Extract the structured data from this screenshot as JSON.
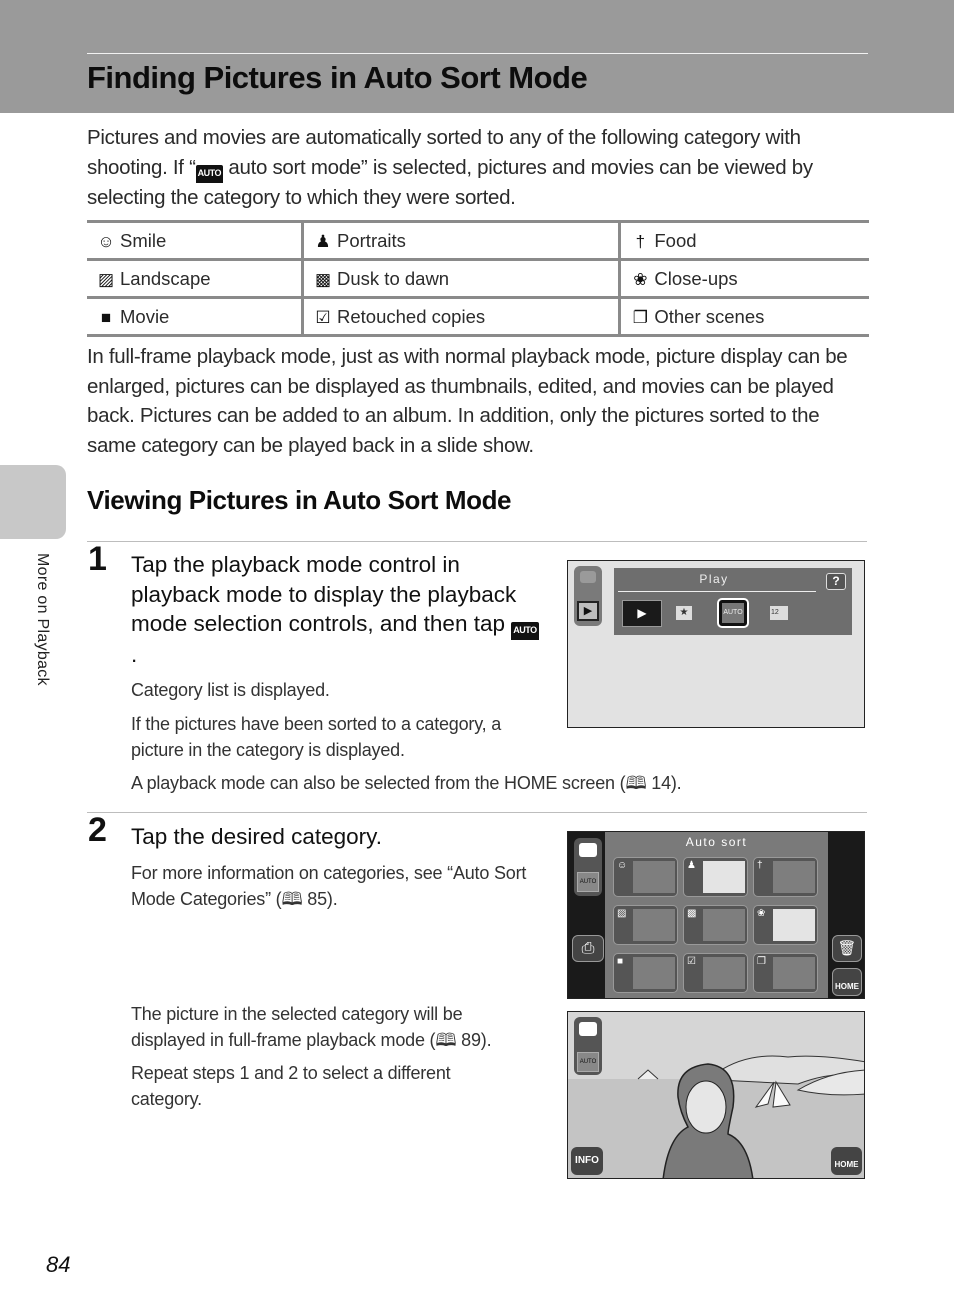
{
  "header": {
    "title": "Finding Pictures in Auto Sort Mode"
  },
  "intro": {
    "part1": "Pictures and movies are automatically sorted to any of the following category with shooting. If “",
    "icon": "AUTO",
    "part2": " auto sort mode” is selected, pictures and movies can be viewed by selecting the category to which they were sorted."
  },
  "categories": [
    [
      {
        "icon": "smile-icon",
        "glyph": "☺",
        "label": "Smile"
      },
      {
        "icon": "portrait-icon",
        "glyph": "♟",
        "label": "Portraits"
      },
      {
        "icon": "food-icon",
        "glyph": "†",
        "label": "Food"
      }
    ],
    [
      {
        "icon": "landscape-icon",
        "glyph": "▨",
        "label": "Landscape"
      },
      {
        "icon": "dusk-icon",
        "glyph": "▩",
        "label": "Dusk to dawn"
      },
      {
        "icon": "closeup-icon",
        "glyph": "❀",
        "label": "Close-ups"
      }
    ],
    [
      {
        "icon": "movie-icon",
        "glyph": "■",
        "label": "Movie"
      },
      {
        "icon": "retouch-icon",
        "glyph": "☑",
        "label": "Retouched copies"
      },
      {
        "icon": "other-scenes-icon",
        "glyph": "❐",
        "label": "Other scenes"
      }
    ]
  ],
  "paragraph2": "In full-frame playback mode, just as with normal playback mode, picture display can be enlarged, pictures can be displayed as thumbnails, edited, and movies can be played back. Pictures can be added to an album. In addition, only the pictures sorted to the same category can be played back in a slide show.",
  "side_tab": {
    "label": "More on Playback"
  },
  "section": {
    "title": "Viewing Pictures in Auto Sort Mode"
  },
  "steps": [
    {
      "number": "1",
      "title": "Tap the playback mode control in playback mode to display the playback mode selection controls, and then tap",
      "title_icon": "AUTO",
      "notes": [
        "Category list is displayed.",
        "If the pictures have been sorted to a category, a picture in the category is displayed.",
        "A playback mode can also be selected from the HOME screen (🕮 14)."
      ]
    },
    {
      "number": "2",
      "title": "Tap the desired category.",
      "notes": [
        "For more information on categories, see “Auto Sort Mode Categories” (🕮 85).",
        "The picture in the selected category will be displayed in full-frame playback mode (🕮 89).",
        "Repeat steps 1 and 2 to select a different category."
      ]
    }
  ],
  "screen1": {
    "menu_title": "Play",
    "help": "?",
    "auto_label": "AUTO",
    "list_label": "12"
  },
  "screen2": {
    "title": "Auto sort",
    "auto_label": "AUTO",
    "home_label": "HOME"
  },
  "screen3": {
    "auto_label": "AUTO",
    "info_label": "INFO",
    "home_label": "HOME"
  },
  "page_number": "84"
}
